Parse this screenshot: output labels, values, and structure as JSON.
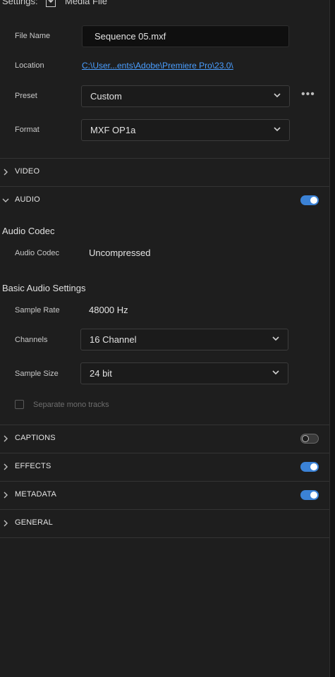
{
  "header": {
    "settings_label": "Settings:",
    "media_file_label": "Media File",
    "download_icon": "download-icon"
  },
  "general": {
    "file_name_label": "File Name",
    "file_name_value": "Sequence 05.mxf",
    "location_label": "Location",
    "location_value": "C:\\User...ents\\Adobe\\Premiere Pro\\23.0\\",
    "preset_label": "Preset",
    "preset_value": "Custom",
    "more_label": "•••",
    "format_label": "Format",
    "format_value": "MXF OP1a"
  },
  "sections": {
    "video": {
      "title": "VIDEO"
    },
    "audio": {
      "title": "AUDIO",
      "enabled": true
    },
    "captions": {
      "title": "CAPTIONS",
      "enabled": false
    },
    "effects": {
      "title": "EFFECTS",
      "enabled": true
    },
    "metadata": {
      "title": "METADATA",
      "enabled": true
    },
    "general": {
      "title": "GENERAL"
    }
  },
  "audio": {
    "codec_heading": "Audio Codec",
    "codec_label": "Audio Codec",
    "codec_value": "Uncompressed",
    "basic_heading": "Basic Audio Settings",
    "sample_rate_label": "Sample Rate",
    "sample_rate_value": "48000 Hz",
    "channels_label": "Channels",
    "channels_value": "16 Channel",
    "sample_size_label": "Sample Size",
    "sample_size_value": "24 bit",
    "mono_label": "Separate mono tracks",
    "mono_checked": false
  },
  "colors": {
    "accent": "#3b82d6",
    "link": "#4a9eff",
    "background": "#1e1e1e"
  }
}
